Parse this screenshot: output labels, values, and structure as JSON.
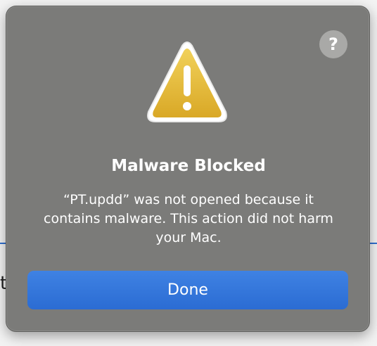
{
  "backdrop": {
    "partial_glyph": "t"
  },
  "dialog": {
    "help_label": "?",
    "icon": "warning-triangle-icon",
    "title": "Malware Blocked",
    "message": "“PT.updd” was not opened because it contains malware. This action did not harm your Mac.",
    "done_label": "Done"
  },
  "colors": {
    "dialog_background": "#7b7b79",
    "primary_button": "#2f70d8",
    "warning_yellow": "#e5b931",
    "text": "#ffffff"
  }
}
